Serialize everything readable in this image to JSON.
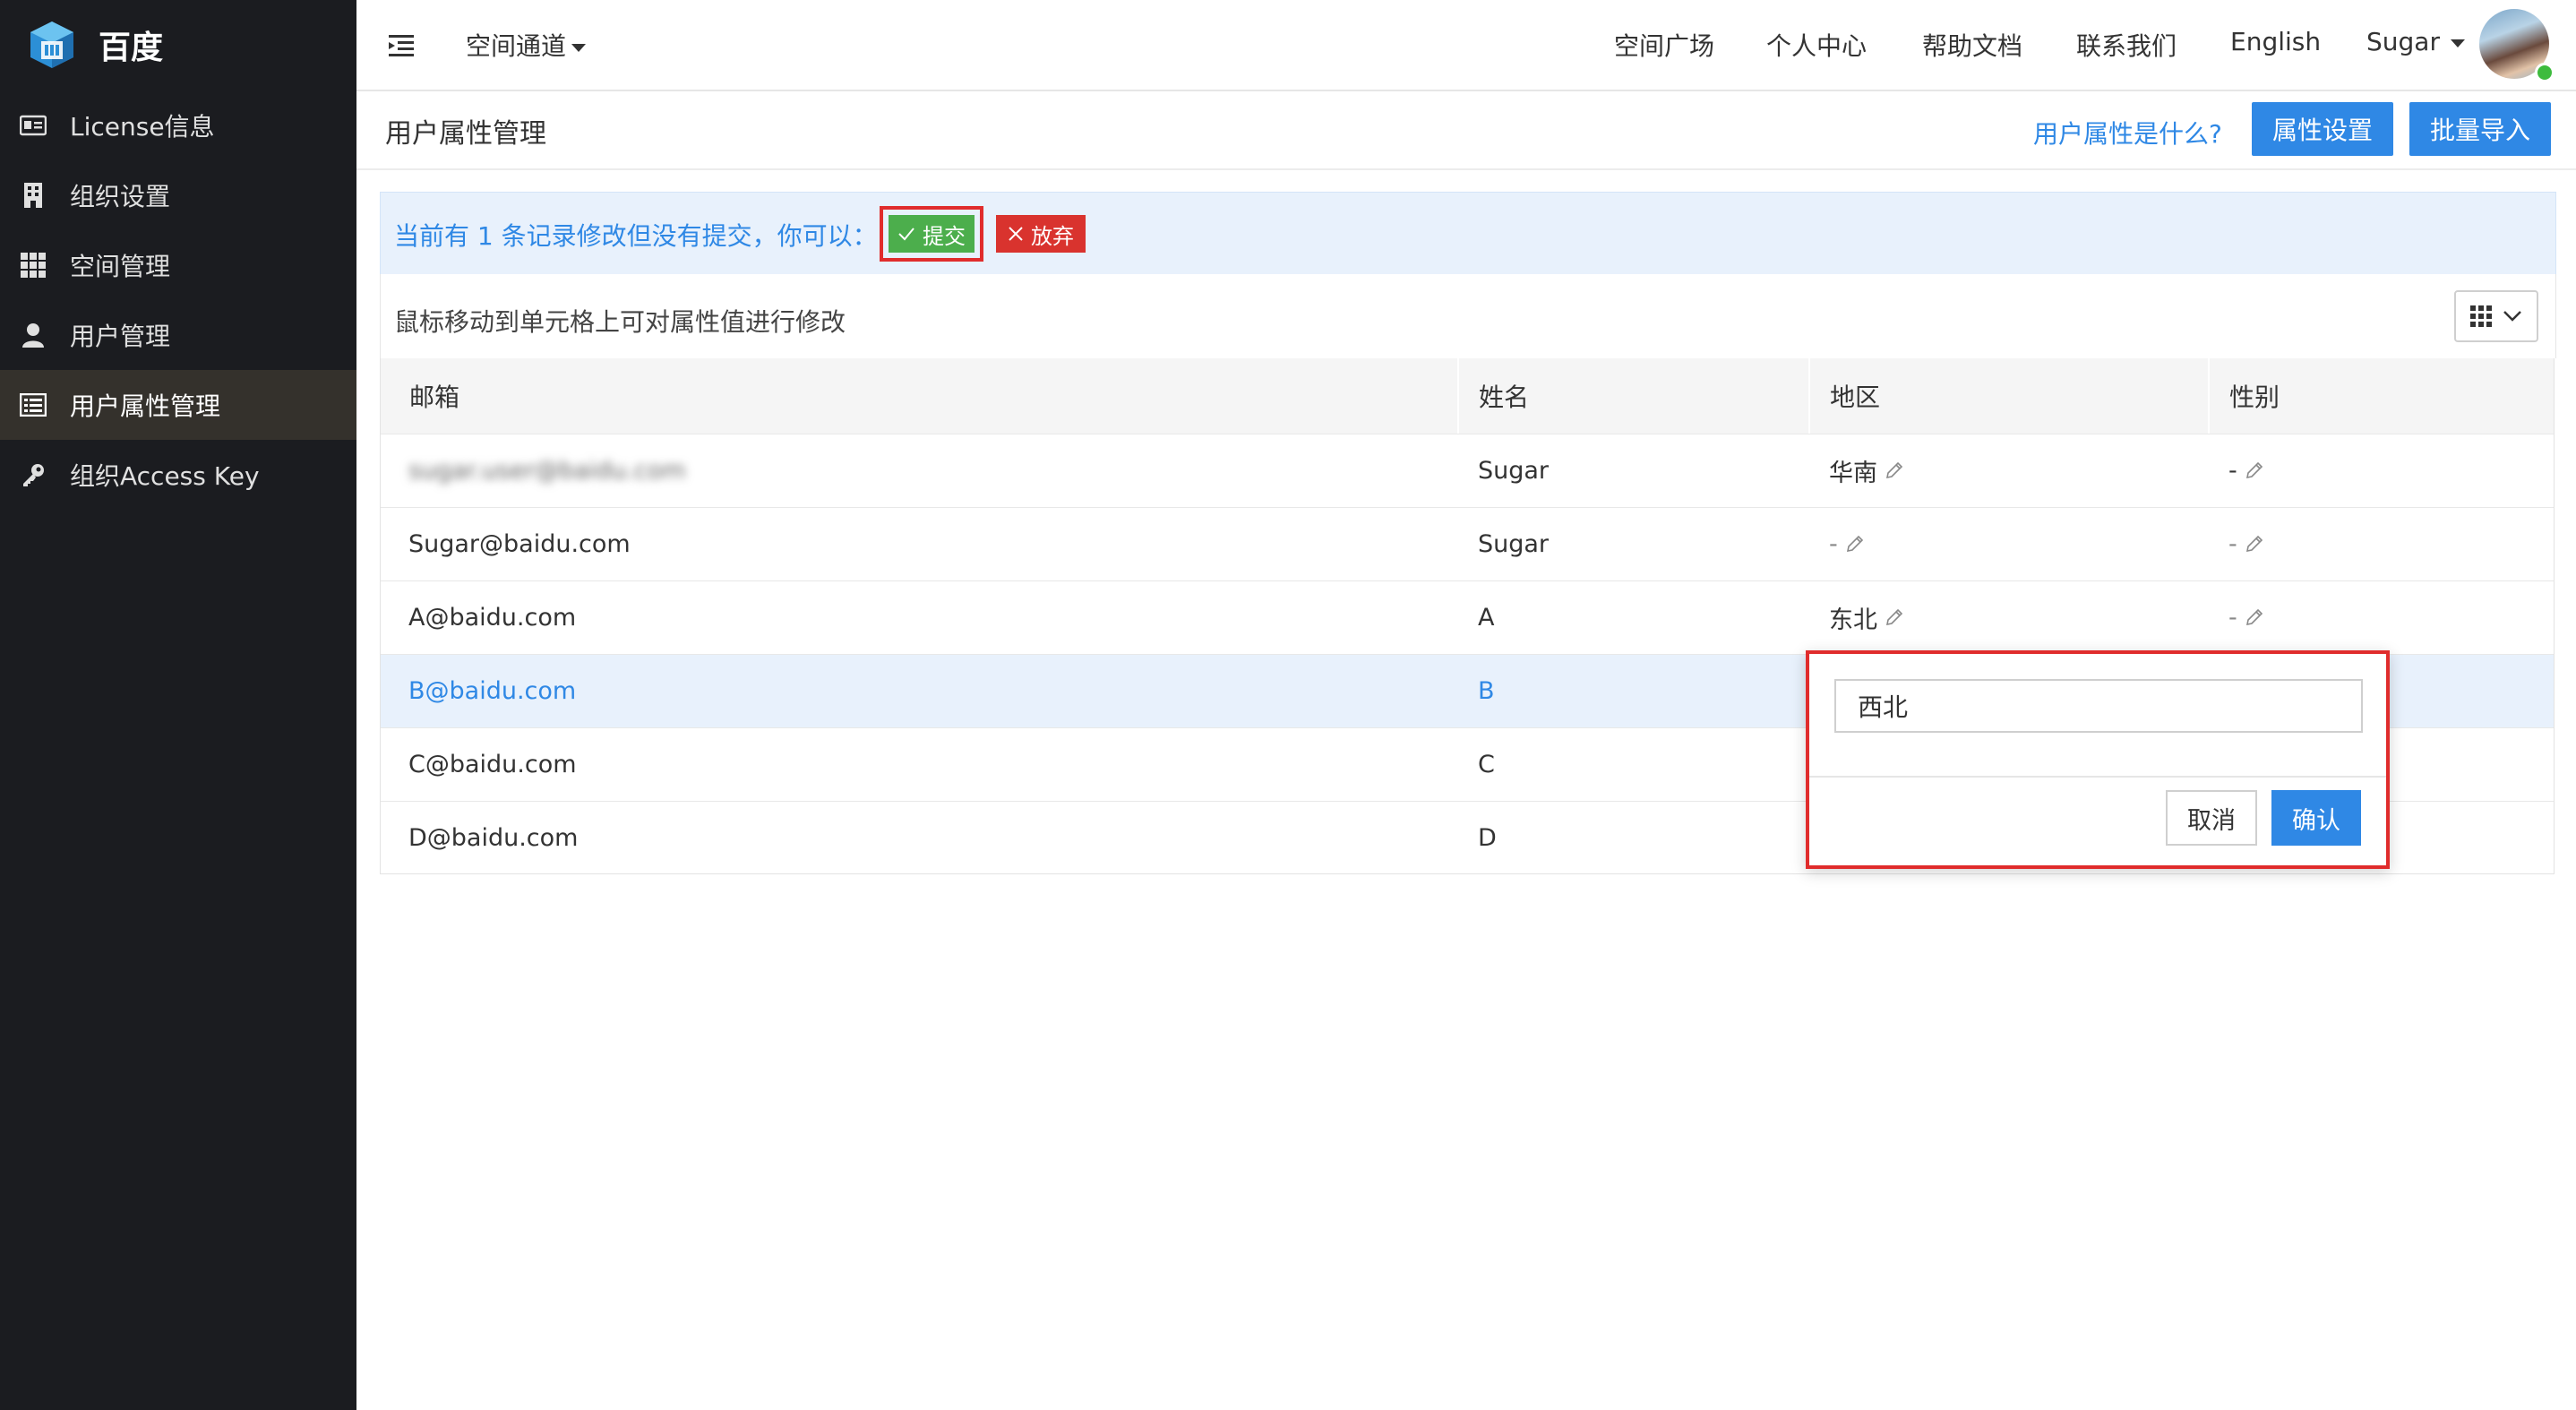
{
  "brand": {
    "name": "百度",
    "logo_icon": "cube-logo-icon"
  },
  "sidebar": {
    "items": [
      {
        "label": "License信息",
        "icon": "id-card-icon",
        "active": false
      },
      {
        "label": "组织设置",
        "icon": "building-icon",
        "active": false
      },
      {
        "label": "空间管理",
        "icon": "grid-icon",
        "active": false
      },
      {
        "label": "用户管理",
        "icon": "user-icon",
        "active": false
      },
      {
        "label": "用户属性管理",
        "icon": "list-icon",
        "active": true
      },
      {
        "label": "组织Access Key",
        "icon": "key-icon",
        "active": false
      }
    ]
  },
  "topbar": {
    "space_switch": "空间通道",
    "links": [
      "空间广场",
      "个人中心",
      "帮助文档",
      "联系我们",
      "English"
    ],
    "user_name": "Sugar"
  },
  "page": {
    "title": "用户属性管理",
    "help_link": "用户属性是什么?",
    "btn_attr_settings": "属性设置",
    "btn_batch_import": "批量导入"
  },
  "notice": {
    "text": "当前有 1 条记录修改但没有提交，你可以：",
    "submit": "提交",
    "discard": "放弃"
  },
  "hint": "鼠标移动到单元格上可对属性值进行修改",
  "table": {
    "headers": [
      "邮箱",
      "姓名",
      "地区",
      "性别"
    ],
    "rows": [
      {
        "email": "sugar.user@baidu.com",
        "name": "Sugar",
        "region": "华南",
        "gender": "-"
      },
      {
        "email": "Sugar@baidu.com",
        "name": "Sugar",
        "region": "-",
        "gender": "-"
      },
      {
        "email": "A@baidu.com",
        "name": "A",
        "region": "东北",
        "gender": "-"
      },
      {
        "email": "B@baidu.com",
        "name": "B",
        "region": "",
        "gender": ""
      },
      {
        "email": "C@baidu.com",
        "name": "C",
        "region": "",
        "gender": ""
      },
      {
        "email": "D@baidu.com",
        "name": "D",
        "region": "",
        "gender": ""
      }
    ]
  },
  "popover": {
    "value": "西北",
    "cancel": "取消",
    "confirm": "确认"
  },
  "colors": {
    "primary": "#2f88e5",
    "success": "#4cae4c",
    "danger": "#d9332e",
    "highlight": "#e02c2c",
    "sidebar_bg": "#1b1c20",
    "online": "#3dbb3d"
  }
}
